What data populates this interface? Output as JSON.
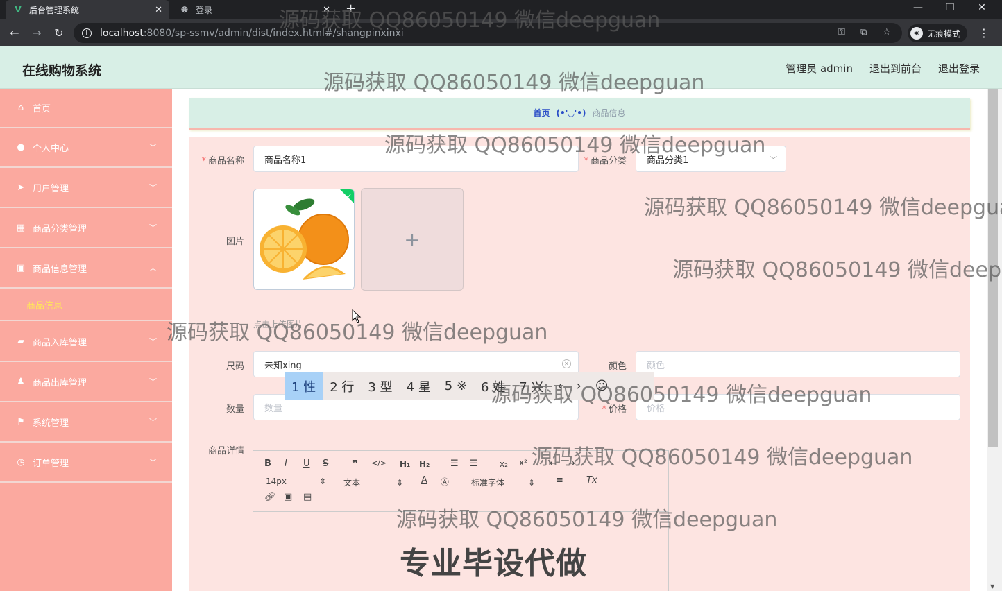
{
  "browser": {
    "tabs": [
      {
        "title": "后台管理系统",
        "icon": "vue-logo-icon",
        "active": true
      },
      {
        "title": "登录",
        "icon": "globe-icon",
        "active": false
      }
    ],
    "url_host": "localhost",
    "url_path": ":8080/sp-ssmv/admin/dist/index.html#/shangpinxinxi",
    "profile": "无痕模式"
  },
  "header": {
    "brand": "在线购物系统",
    "user": "管理员 admin",
    "to_front": "退出到前台",
    "logout": "退出登录"
  },
  "sidebar": {
    "items": [
      {
        "label": "首页",
        "icon": "home-icon"
      },
      {
        "label": "个人中心",
        "icon": "user-icon"
      },
      {
        "label": "用户管理",
        "icon": "send-icon"
      },
      {
        "label": "商品分类管理",
        "icon": "grid-icon"
      },
      {
        "label": "商品信息管理",
        "icon": "document-icon"
      },
      {
        "label": "商品入库管理",
        "icon": "truck-icon"
      },
      {
        "label": "商品出库管理",
        "icon": "person-icon"
      },
      {
        "label": "系统管理",
        "icon": "flag-icon"
      },
      {
        "label": "订单管理",
        "icon": "clock-icon"
      }
    ],
    "sub_active": "商品信息"
  },
  "breadcrumb": {
    "home": "首页",
    "sep": "(•'◡'•)",
    "current": "商品信息"
  },
  "form": {
    "name_label": "商品名称",
    "name_value": "商品名称1",
    "category_label": "商品分类",
    "category_value": "商品分类1",
    "image_label": "图片",
    "upload_hint": "点击上传图片",
    "size_label": "尺码",
    "size_value": "未知xing",
    "color_label": "颜色",
    "color_placeholder": "颜色",
    "qty_label": "数量",
    "qty_placeholder": "数量",
    "price_label": "价格",
    "price_placeholder": "价格",
    "detail_label": "商品详情"
  },
  "ime": {
    "candidates": [
      "1 性",
      "2 行",
      "3 型",
      "4 星",
      "5 ※",
      "6 姓",
      "7 兴"
    ]
  },
  "editor": {
    "font_size": "14px",
    "header_type": "文本",
    "font_family": "标准字体"
  },
  "watermarks": {
    "text": "源码获取 QQ86050149 微信deepguan",
    "big": "专业毕设代做"
  }
}
